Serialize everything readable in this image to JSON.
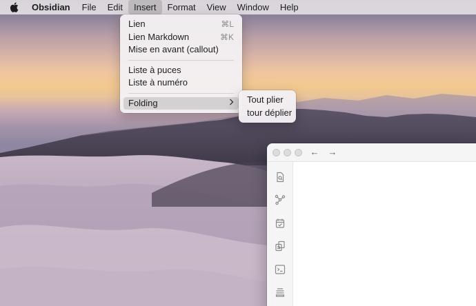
{
  "menubar": {
    "app_name": "Obsidian",
    "menus": [
      "File",
      "Edit",
      "Insert",
      "Format",
      "View",
      "Window",
      "Help"
    ],
    "active_menu": "Insert"
  },
  "insert_menu": {
    "items": [
      {
        "label": "Lien",
        "shortcut": "⌘L"
      },
      {
        "label": "Lien Markdown",
        "shortcut": "⌘K"
      },
      {
        "label": "Mise en avant (callout)"
      },
      {
        "label": "Liste à puces"
      },
      {
        "label": "Liste à numéro"
      },
      {
        "label": "Folding",
        "submenu": true,
        "highlighted": true
      }
    ]
  },
  "folding_submenu": {
    "items": [
      {
        "label": "Tout plier"
      },
      {
        "label": "tour déplier"
      }
    ]
  },
  "window": {
    "nav_back": "←",
    "nav_forward": "→",
    "ribbon_icons": [
      "search-file-icon",
      "graph-view-icon",
      "daily-note-icon",
      "templates-icon",
      "command-palette-icon",
      "slides-icon"
    ]
  },
  "colors": {
    "menu_bg": "#f3f0f2",
    "highlight": "#dadada",
    "window_bg": "#ffffff"
  }
}
